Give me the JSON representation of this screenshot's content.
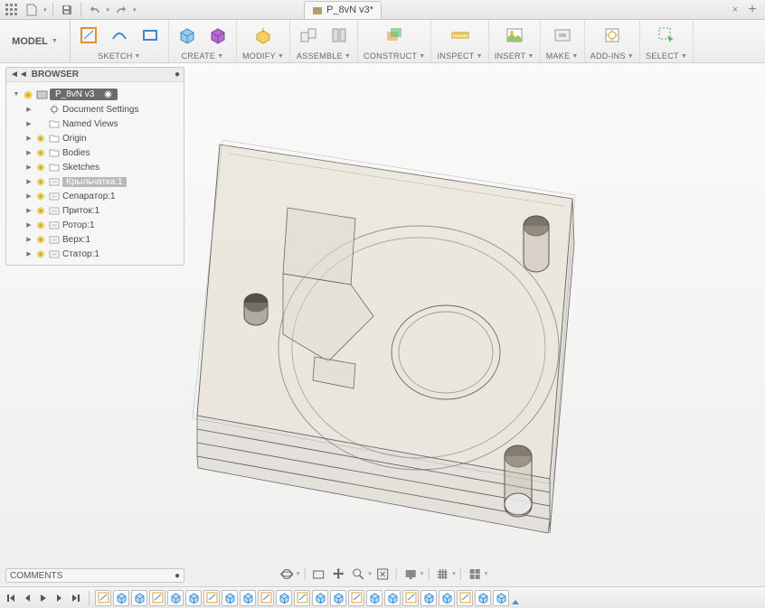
{
  "doc_tab": {
    "title": "P_8vN v3*"
  },
  "ribbon": {
    "model_label": "MODEL",
    "groups": [
      {
        "name": "sketch",
        "label": "SKETCH"
      },
      {
        "name": "create",
        "label": "CREATE"
      },
      {
        "name": "modify",
        "label": "MODIFY"
      },
      {
        "name": "assemble",
        "label": "ASSEMBLE"
      },
      {
        "name": "construct",
        "label": "CONSTRUCT"
      },
      {
        "name": "inspect",
        "label": "INSPECT"
      },
      {
        "name": "insert",
        "label": "INSERT"
      },
      {
        "name": "make",
        "label": "MAKE"
      },
      {
        "name": "addins",
        "label": "ADD-INS"
      },
      {
        "name": "select",
        "label": "SELECT"
      }
    ]
  },
  "browser": {
    "title": "BROWSER",
    "root": "P_8vN v3",
    "nodes": [
      {
        "icon": "gear",
        "label": "Document Settings",
        "bulb": null
      },
      {
        "icon": "folder",
        "label": "Named Views",
        "bulb": null
      },
      {
        "icon": "folder",
        "label": "Origin",
        "bulb": "on"
      },
      {
        "icon": "folder",
        "label": "Bodies",
        "bulb": "on"
      },
      {
        "icon": "folder",
        "label": "Sketches",
        "bulb": "on"
      },
      {
        "icon": "comp",
        "label": "Крыльчатка:1",
        "bulb": "on",
        "selected": true
      },
      {
        "icon": "comp",
        "label": "Сепаратор:1",
        "bulb": "on"
      },
      {
        "icon": "comp",
        "label": "Приток:1",
        "bulb": "on"
      },
      {
        "icon": "comp",
        "label": "Ротор:1",
        "bulb": "on"
      },
      {
        "icon": "comp",
        "label": "Верх:1",
        "bulb": "on"
      },
      {
        "icon": "comp",
        "label": "Статор:1",
        "bulb": "on"
      }
    ]
  },
  "comments": {
    "title": "COMMENTS"
  },
  "view_toolbar": {
    "tools": [
      "orbit",
      "sep",
      "pan",
      "zoom",
      "zoom-fit",
      "look-at",
      "sep",
      "display-dd",
      "sep",
      "effects-dd",
      "sep",
      "grid-dd",
      "sep",
      "viewports-dd"
    ]
  },
  "timeline": {
    "playback": [
      "go-start",
      "step-back",
      "play",
      "step-fwd",
      "go-end"
    ],
    "features": [
      "sketch",
      "extrude",
      "extrude",
      "sketch",
      "extrude",
      "extrude",
      "sketch",
      "extrude",
      "extrude",
      "sketch",
      "extrude",
      "sketch",
      "extrude",
      "extrude",
      "sketch",
      "extrude",
      "extrude",
      "sketch",
      "extrude",
      "extrude",
      "sketch",
      "extrude",
      "extrude"
    ]
  }
}
